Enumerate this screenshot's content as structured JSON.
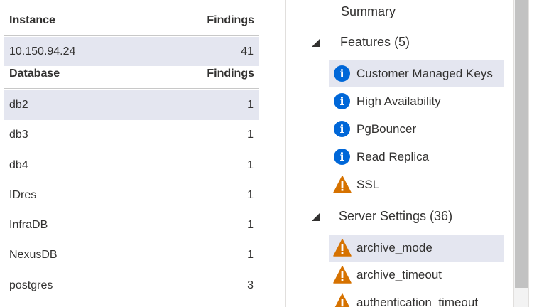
{
  "instance_table": {
    "col_name": "Instance",
    "col_findings": "Findings",
    "rows": [
      {
        "name": "10.150.94.24",
        "findings": "41"
      }
    ]
  },
  "database_table": {
    "col_name": "Database",
    "col_findings": "Findings",
    "rows": [
      {
        "name": "db2",
        "findings": "1"
      },
      {
        "name": "db3",
        "findings": "1"
      },
      {
        "name": "db4",
        "findings": "1"
      },
      {
        "name": "IDres",
        "findings": "1"
      },
      {
        "name": "InfraDB",
        "findings": "1"
      },
      {
        "name": "NexusDB",
        "findings": "1"
      },
      {
        "name": "postgres",
        "findings": "3"
      }
    ]
  },
  "tree": {
    "summary": "Summary",
    "groups": [
      {
        "label": "Features (5)",
        "items": [
          {
            "label": "Customer Managed Keys",
            "icon": "info-icon"
          },
          {
            "label": "High Availability",
            "icon": "info-icon"
          },
          {
            "label": "PgBouncer",
            "icon": "info-icon"
          },
          {
            "label": "Read Replica",
            "icon": "info-icon"
          },
          {
            "label": "SSL",
            "icon": "warning-icon"
          }
        ]
      },
      {
        "label": "Server Settings (36)",
        "items": [
          {
            "label": "archive_mode",
            "icon": "warning-icon"
          },
          {
            "label": "archive_timeout",
            "icon": "warning-icon"
          },
          {
            "label": "authentication_timeout",
            "icon": "warning-icon"
          }
        ]
      }
    ]
  },
  "colors": {
    "info": "#0067d8",
    "warning": "#d67200",
    "selection": "#e4e6f0"
  }
}
